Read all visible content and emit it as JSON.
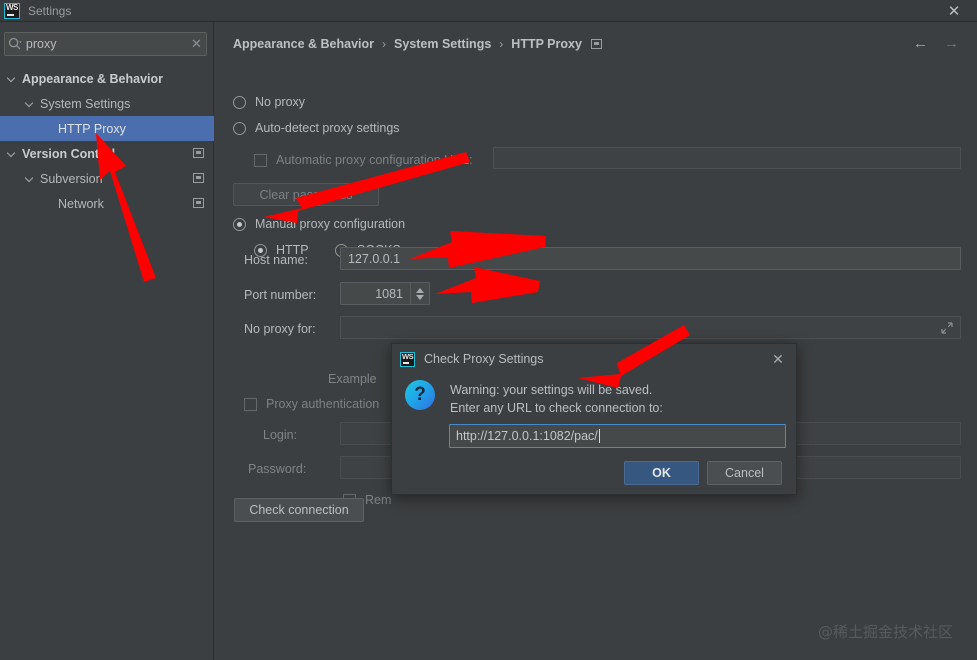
{
  "window": {
    "title": "Settings",
    "logo_icon": "webstorm-logo-icon",
    "close_label": "✕"
  },
  "search": {
    "value": "proxy",
    "placeholder": "Search settings",
    "icon": "search-icon",
    "clear_label": "✕"
  },
  "sidebar": {
    "items": [
      {
        "label": "Appearance & Behavior",
        "indent": 0,
        "bold": true,
        "expandable": true,
        "selected": false,
        "badge": false
      },
      {
        "label": "System Settings",
        "indent": 1,
        "bold": false,
        "expandable": true,
        "selected": false,
        "badge": false
      },
      {
        "label": "HTTP Proxy",
        "indent": 2,
        "bold": false,
        "expandable": false,
        "selected": true,
        "badge": false
      },
      {
        "label": "Version Control",
        "indent": 0,
        "bold": true,
        "expandable": true,
        "selected": false,
        "badge": true
      },
      {
        "label": "Subversion",
        "indent": 1,
        "bold": false,
        "expandable": true,
        "selected": false,
        "badge": true
      },
      {
        "label": "Network",
        "indent": 2,
        "bold": false,
        "expandable": false,
        "selected": false,
        "badge": true
      }
    ]
  },
  "breadcrumb": {
    "crumbs": [
      "Appearance & Behavior",
      "System Settings",
      "HTTP Proxy"
    ],
    "separator": "›",
    "badge_icon": "config-badge-icon"
  },
  "nav": {
    "back_label": "←",
    "forward_label": "→"
  },
  "main": {
    "no_proxy_label": "No proxy",
    "auto_detect_label": "Auto-detect proxy settings",
    "auto_config_url_label": "Automatic proxy configuration URL:",
    "auto_config_url_value": "",
    "clear_passwords_label": "Clear passwords",
    "manual_label": "Manual proxy configuration",
    "http_label": "HTTP",
    "socks_label": "SOCKS",
    "host_name_label": "Host name:",
    "host_name_value": "127.0.0.1",
    "port_number_label": "Port number:",
    "port_number_value": "1081",
    "no_proxy_for_label": "No proxy for:",
    "no_proxy_for_value": "",
    "example_label": "Example",
    "proxy_auth_label": "Proxy authentication",
    "login_label": "Login:",
    "login_value": "",
    "password_label": "Password:",
    "password_value": "",
    "remember_label": "Rem",
    "check_connection_label": "Check connection",
    "expand_icon": "expand-icon"
  },
  "dialog": {
    "logo_icon": "webstorm-logo-icon",
    "title": "Check Proxy Settings",
    "close_label": "✕",
    "question_icon": "question-mark-icon",
    "message_line1": "Warning: your settings will be saved.",
    "message_line2": "Enter any URL to check connection to:",
    "url_value": "http://127.0.0.1:1082/pac/",
    "ok_label": "OK",
    "cancel_label": "Cancel"
  },
  "watermark": {
    "text": "@稀土掘金技术社区"
  },
  "colors": {
    "background": "#3c3f41",
    "selection": "#4b6eaf",
    "accent_button": "#365880",
    "annotation": "#fe0000",
    "focus_border": "#4a88c7"
  }
}
